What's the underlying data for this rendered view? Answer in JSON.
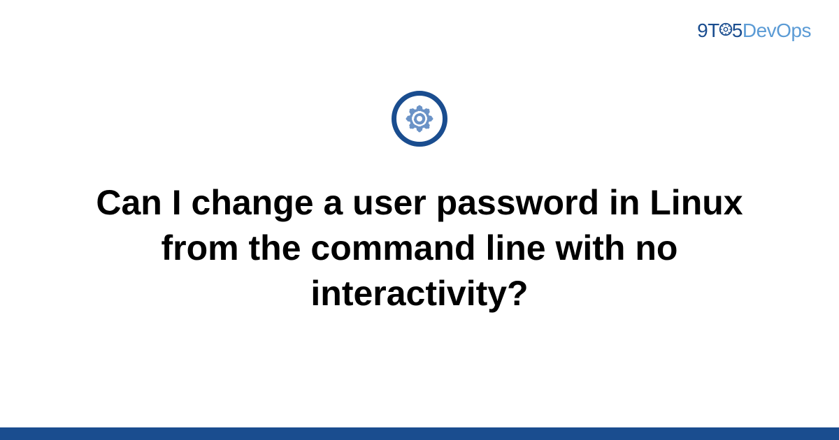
{
  "logo": {
    "part1": "9T",
    "part2": "5",
    "part3": "DevOps"
  },
  "icon": {
    "name": "gear-icon"
  },
  "title": "Can I change a user password in Linux from the command line with no interactivity?",
  "colors": {
    "primary": "#1a4d8f",
    "accent": "#5b9bd5"
  }
}
